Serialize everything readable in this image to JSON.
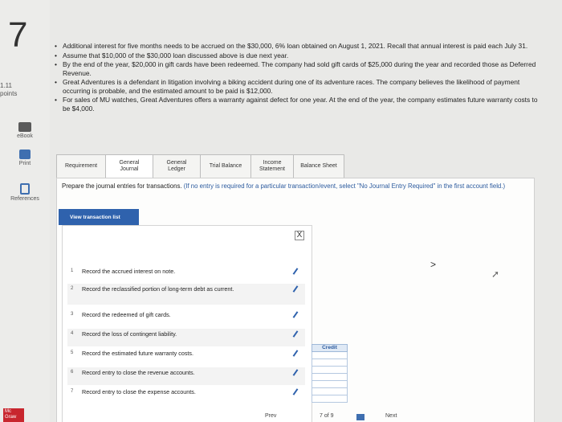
{
  "question": {
    "number": "7",
    "points_value": "1.11",
    "points_label": "points"
  },
  "sidebar": {
    "ebook": "eBook",
    "print": "Print",
    "references": "References"
  },
  "logo": {
    "line1": "Mc",
    "line2": "Graw"
  },
  "bullets": [
    "Additional interest for five months needs to be accrued on the $30,000, 6% loan obtained on August 1, 2021. Recall that annual interest is paid each July 31.",
    "Assume that $10,000 of the $30,000 loan discussed above is due next year.",
    "By the end of the year, $20,000 in gift cards have been redeemed. The company had sold gift cards of $25,000 during the year and recorded those as Deferred Revenue.",
    "Great Adventures is a defendant in litigation involving a biking accident during one of its adventure races. The company believes the likelihood of payment occurring is probable, and the estimated amount to be paid is $12,000.",
    "For sales of MU watches, Great Adventures offers a warranty against defect for one year. At the end of the year, the company estimates future warranty costs to be $4,000."
  ],
  "tabs": [
    {
      "line1": "Requirement",
      "line2": ""
    },
    {
      "line1": "General",
      "line2": "Journal"
    },
    {
      "line1": "General",
      "line2": "Ledger"
    },
    {
      "line1": "Trial Balance",
      "line2": ""
    },
    {
      "line1": "Income",
      "line2": "Statement"
    },
    {
      "line1": "Balance Sheet",
      "line2": ""
    }
  ],
  "instructions": {
    "main": "Prepare the journal entries for transactions.",
    "note": "(If no entry is required for a particular transaction/event, select \"No Journal Entry Required\" in the first account field.)"
  },
  "view_button": "View transaction list",
  "close_symbol": "X",
  "transactions": [
    {
      "num": "1",
      "label": "Record the accrued interest on note."
    },
    {
      "num": "2",
      "label": "Record the reclassified portion of long-term debt as current."
    },
    {
      "num": "3",
      "label": "Record the redeemed of gift cards."
    },
    {
      "num": "4",
      "label": "Record the loss of contingent liability."
    },
    {
      "num": "5",
      "label": "Record the estimated future warranty costs."
    },
    {
      "num": "6",
      "label": "Record entry to close the revenue accounts."
    },
    {
      "num": "7",
      "label": "Record entry to close the expense accounts."
    }
  ],
  "next_chevron": ">",
  "credit_header": "Credit",
  "bottom_nav": {
    "prev": "Prev",
    "page": "7 of 9",
    "next": "Next"
  },
  "colors": {
    "accent": "#2f62ad",
    "logo_red": "#c8262e"
  }
}
